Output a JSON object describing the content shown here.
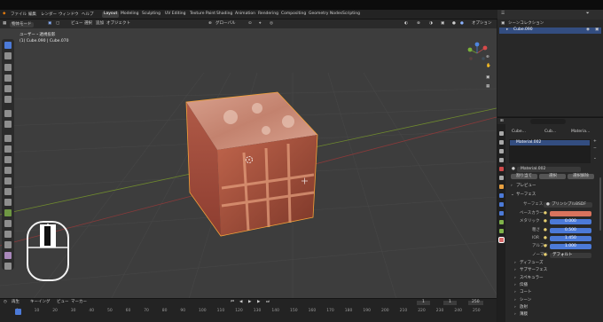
{
  "menubar": {
    "items": [
      "ファイル",
      "編集",
      "レンダー",
      "ウィンドウ",
      "ヘルプ"
    ],
    "workspaces": [
      "Layout",
      "Modeling",
      "Sculpting",
      "UV Editing",
      "Texture Paint",
      "Shading",
      "Animation",
      "Rendering",
      "Compositing",
      "Geometry Nodes",
      "Scripting"
    ],
    "active_workspace": "Layout",
    "scene": "Scene",
    "view_layer": "ViewLayer"
  },
  "viewport_header": {
    "mode": "物体モード",
    "menus": [
      "ビュー",
      "選択",
      "追加",
      "オブジェクト"
    ],
    "orientation": "グローバル",
    "options": "オプション"
  },
  "overlay": {
    "view_name": "ユーザー・透視投影",
    "object_info": "(1) Cube.090 | Cube.070"
  },
  "timeline": {
    "menus": [
      "再生",
      "キーイング",
      "ビュー",
      "マーカー"
    ],
    "current_frame": "1",
    "start": "1",
    "end": "250",
    "ticks": [
      "0",
      "10",
      "20",
      "30",
      "40",
      "50",
      "60",
      "70",
      "80",
      "90",
      "100",
      "110",
      "120",
      "130",
      "140",
      "150",
      "160",
      "170",
      "180",
      "190",
      "200",
      "210",
      "220",
      "230",
      "240",
      "250"
    ]
  },
  "outliner": {
    "header": "シーンコレクション",
    "items": [
      {
        "label": "コレクション"
      },
      {
        "label": "Cube.090"
      }
    ]
  },
  "properties": {
    "breadcrumb": [
      "Cube...",
      "Cub...",
      "Materia..."
    ],
    "material_slot": "Material.002",
    "material_name": "Material.002",
    "buttons": [
      "割り当て",
      "選択",
      "選択解除"
    ],
    "preview_panel": "プレビュー",
    "surface_panel": "サーフェス",
    "surface_label": "サーフェス",
    "surface_value": "プリンシプルBSDF",
    "fields": [
      {
        "label": "ベースカラー",
        "value": "",
        "kind": "color",
        "color": "#d9735d"
      },
      {
        "label": "メタリック",
        "value": "0.000",
        "kind": "num"
      },
      {
        "label": "粗さ",
        "value": "0.500",
        "kind": "num"
      },
      {
        "label": "IOR",
        "value": "1.450",
        "kind": "num"
      },
      {
        "label": "アルファ",
        "value": "1.000",
        "kind": "num"
      },
      {
        "label": "ノーマル",
        "value": "デフォルト",
        "kind": "text"
      }
    ],
    "subpanels": [
      "ディフューズ",
      "サブサーフェス",
      "スペキュラー",
      "伝播",
      "コート",
      "シーン",
      "放射",
      "薄膜"
    ]
  },
  "colors": {
    "accent": "#4c7ad8",
    "cube_top": "#c98a78",
    "cube_left": "#a04a3c",
    "cube_right": "#b0553f"
  }
}
